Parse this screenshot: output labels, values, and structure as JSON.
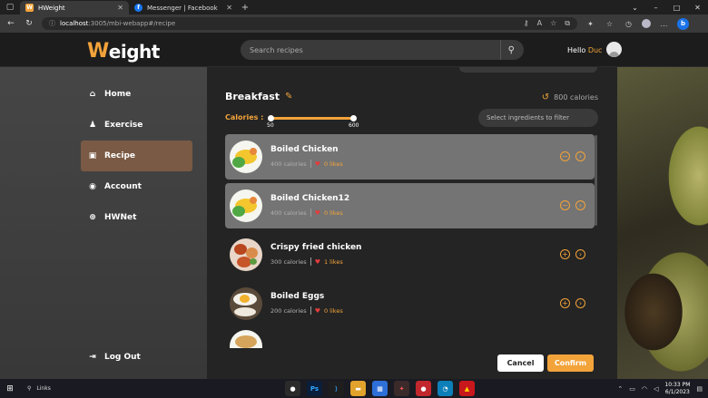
{
  "browser": {
    "tabs": [
      {
        "title": "HWeight",
        "favicon": "W",
        "favicon_color": "#f2a33a",
        "active": true
      },
      {
        "title": "Messenger | Facebook",
        "favicon": "f",
        "favicon_color": "#1877f2",
        "active": false
      }
    ],
    "url_host": "localhost",
    "url_rest": ":3005/mbi-webapp#/recipe"
  },
  "header": {
    "logo_w": "W",
    "logo_rest": "eight",
    "search_placeholder": "Search recipes",
    "greeting": "Hello",
    "user_name": "Duc"
  },
  "sidebar": {
    "items": [
      {
        "label": "Home",
        "icon": "home-icon",
        "glyph": "⌂"
      },
      {
        "label": "Exercise",
        "icon": "person-icon",
        "glyph": "♟"
      },
      {
        "label": "Recipe",
        "icon": "recipe-icon",
        "glyph": "▣",
        "active": true
      },
      {
        "label": "Account",
        "icon": "user-circle-icon",
        "glyph": "◉"
      },
      {
        "label": "HWNet",
        "icon": "globe-icon",
        "glyph": "⊕"
      }
    ],
    "logout_label": "Log Out"
  },
  "meal": {
    "title": "Breakfast",
    "total_calories": "800 calories",
    "calories_label": "Calories :",
    "slider_min": "50",
    "slider_max": "600",
    "filter_placeholder": "Select ingredients to filter"
  },
  "recipes": [
    {
      "name": "Boiled Chicken",
      "calories": "400 calories",
      "likes": "0 likes",
      "selected": true
    },
    {
      "name": "Boiled Chicken12",
      "calories": "400 calories",
      "likes": "0 likes",
      "selected": true
    },
    {
      "name": "Crispy fried chicken",
      "calories": "300 calories",
      "likes": "1 likes",
      "selected": false
    },
    {
      "name": "Boiled Eggs",
      "calories": "200 calories",
      "likes": "0 likes",
      "selected": false
    }
  ],
  "buttons": {
    "cancel": "Cancel",
    "confirm": "Confirm"
  },
  "taskbar": {
    "search_label": "Links",
    "time": "10:33 PM",
    "date": "6/1/2023"
  },
  "colors": {
    "accent": "#f2a33a",
    "selected_row": "#747474",
    "active_nav": "#7a5a44"
  }
}
